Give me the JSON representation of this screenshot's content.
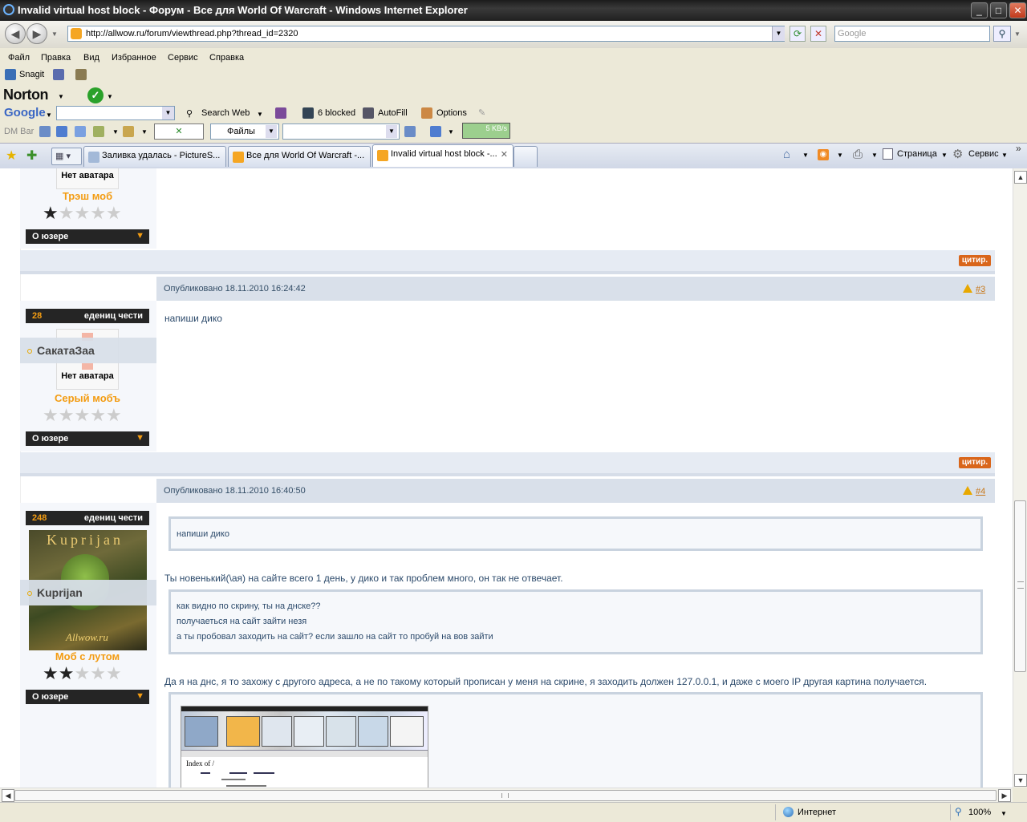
{
  "window": {
    "title": "Invalid virtual host block - Форум - Все для World Of Warcraft - Windows Internet Explorer",
    "controls": {
      "minimize": "_",
      "maximize": "□",
      "close": "✕"
    }
  },
  "address": {
    "url": "http://allwow.ru/forum/viewthread.php?thread_id=2320",
    "search_placeholder": "Google"
  },
  "menu": [
    "Файл",
    "Правка",
    "Вид",
    "Избранное",
    "Сервис",
    "Справка"
  ],
  "toolbars": {
    "snagit": "Snagit",
    "norton": "Norton",
    "google": "Google",
    "search_web": "Search Web",
    "blocked": "6 blocked",
    "autofill": "AutoFill",
    "options": "Options",
    "dmbar": "DM Bar",
    "files": "Файлы",
    "speed": "5 KB/s"
  },
  "tabs": [
    {
      "label": "Заливка удалась - PictureS..."
    },
    {
      "label": "Все для World Of Warcraft -..."
    },
    {
      "label": "Invalid virtual host block -...",
      "active": true
    }
  ],
  "command_bar": {
    "page": "Страница",
    "service": "Сервис"
  },
  "posts": [
    {
      "avatar_text": "Нет аватара",
      "rank": "Трэш моб",
      "stars_filled": 1,
      "stars_total": 5,
      "user_button": "О юзере",
      "quote": "цитир."
    },
    {
      "published": "Опубликовано 18.11.2010 16:24:42",
      "number": "#3",
      "honor_count": "28",
      "honor_label": "едениц чести",
      "username": "СакатаЗаа",
      "avatar_text": "Нет аватара",
      "rank": "Серый мобъ",
      "stars_filled": 0,
      "stars_total": 5,
      "user_button": "О юзере",
      "text": "напиши дико",
      "quote": "цитир."
    },
    {
      "published": "Опубликовано 18.11.2010 16:40:50",
      "number": "#4",
      "honor_count": "248",
      "honor_label": "едениц чести",
      "username": "Kuprijan",
      "avatar_caption_top": "Kuprijan",
      "avatar_caption_bottom": "Allwow.ru",
      "rank": "Моб с лутом",
      "stars_filled": 2,
      "stars_total": 5,
      "user_button": "О юзере",
      "quote1": "напиши дико",
      "reply1": "Ты новенький(\\ая) на сайте всего 1 день, у дико и так проблем много, он так не отвечает.",
      "quote2_lines": [
        "как видно по скрину, ты на днске??",
        "получаеться на сайт зайти незя",
        "а ты пробовал заходить на сайт? если зашло на сайт то пробуй на вов зайти"
      ],
      "reply2": "Да я на днс, я то захожу с другого адреса, а не по такому который прописан у меня на скрине, я заходить должен 127.0.0.1, и даже с моего IP другая картина получается.",
      "screenshot_caption": "Index of /"
    }
  ],
  "status": {
    "zone": "Интернет",
    "zoom": "100%"
  }
}
